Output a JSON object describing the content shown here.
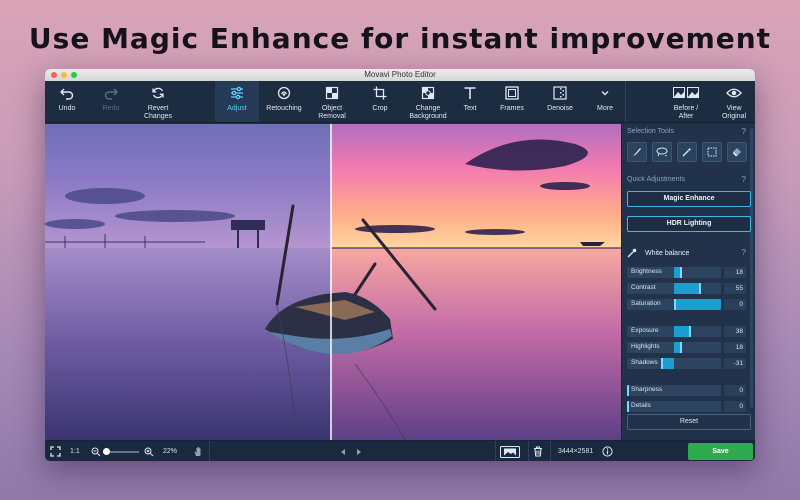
{
  "headline": "Use Magic Enhance for instant improvement",
  "window": {
    "title": "Movavi Photo Editor"
  },
  "toolbar": {
    "undo": "Undo",
    "redo": "Redo",
    "revert": "Revert Changes",
    "adjust": "Adjust",
    "retouching": "Retouching",
    "object_removal": "Object Removal",
    "crop": "Crop",
    "change_background": "Change Background",
    "text": "Text",
    "frames": "Frames",
    "denoise": "Denoise",
    "more": "More",
    "before_after": "Before / After",
    "view_original": "View Original"
  },
  "panel": {
    "selection_tools": "Selection Tools",
    "help": "?",
    "quick_adjustments": "Quick Adjustments",
    "magic_enhance": "Magic Enhance",
    "hdr_lighting": "HDR Lighting",
    "white_balance": "White balance",
    "sliders": [
      {
        "label": "Brightness",
        "value": "18",
        "level": 0.56
      },
      {
        "label": "Contrast",
        "value": "55",
        "level": 0.77
      },
      {
        "label": "Saturation",
        "value": "0",
        "level": 0.5
      },
      {
        "label": "Exposure",
        "value": "38",
        "level": 0.66
      },
      {
        "label": "Highlights",
        "value": "18",
        "level": 0.56
      },
      {
        "label": "Shadows",
        "value": "-31",
        "level": 0.36
      },
      {
        "label": "Sharpness",
        "value": "0",
        "level": 0.0
      },
      {
        "label": "Details",
        "value": "0",
        "level": 0.0
      }
    ],
    "reset": "Reset"
  },
  "status": {
    "ratio": "1:1",
    "zoom": "22%",
    "dimensions": "3444×2581",
    "save": "Save"
  },
  "colors": {
    "accent": "#3fb8e6",
    "save": "#2eaa4f",
    "toolbar_active": "#5fd0ff"
  }
}
